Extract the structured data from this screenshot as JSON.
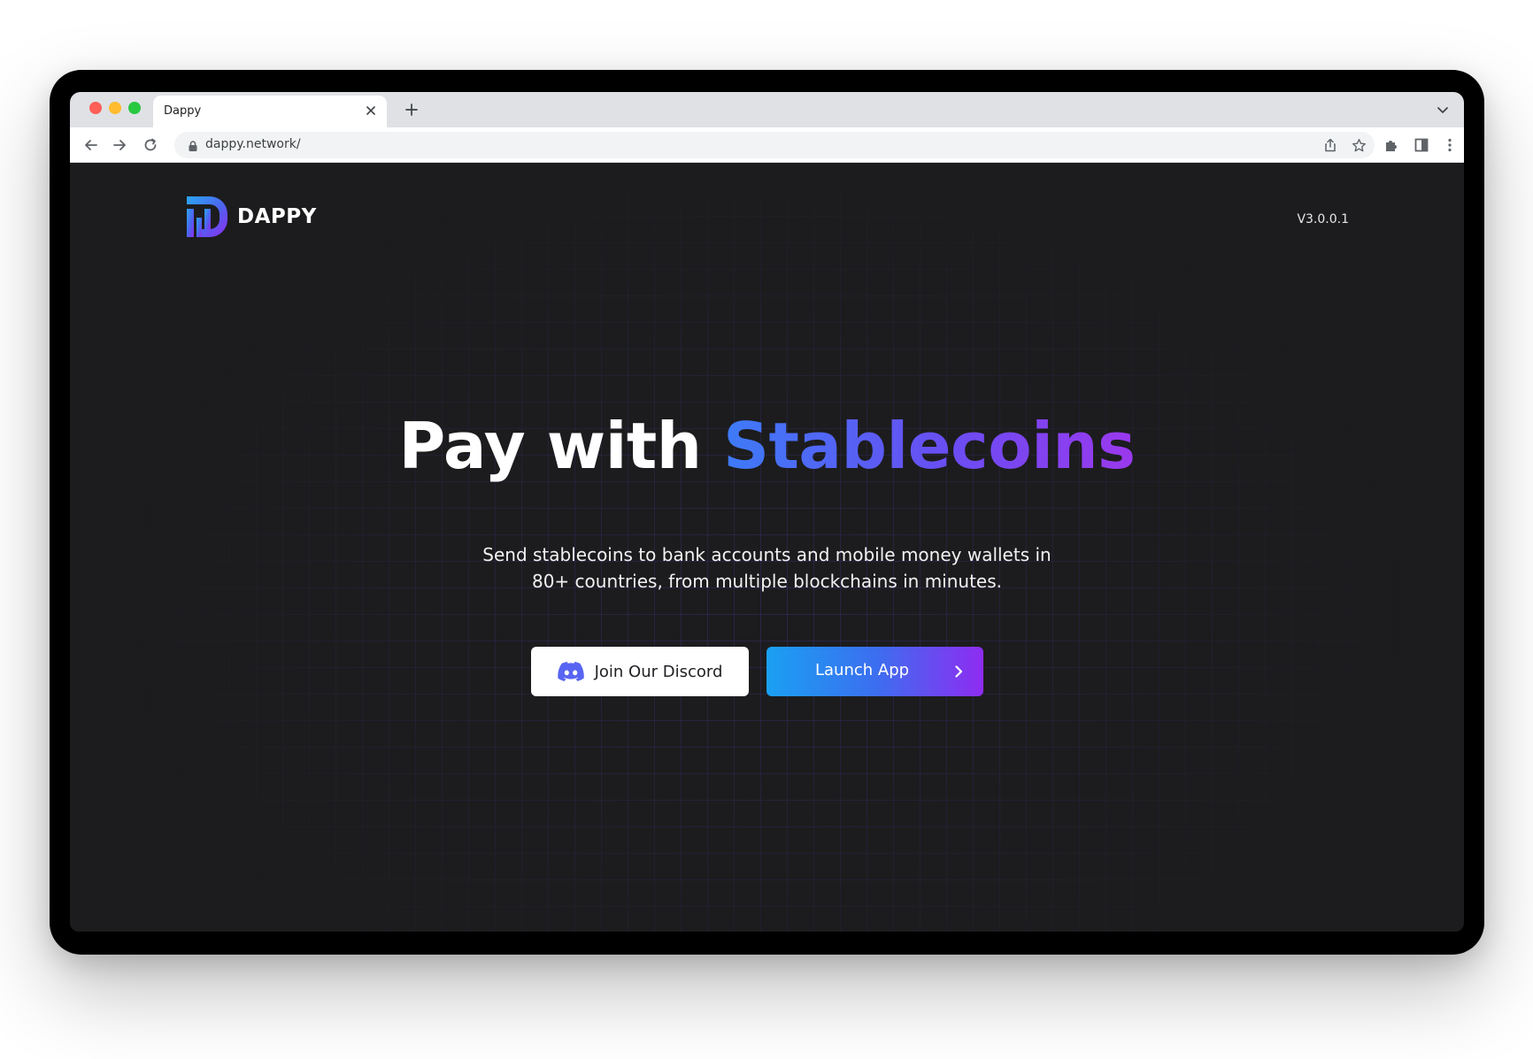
{
  "browser": {
    "tab_title": "Dappy",
    "url": "dappy.network/"
  },
  "icons": {
    "back": "arrow-left-icon",
    "forward": "arrow-right-icon",
    "reload": "reload-icon",
    "lock": "lock-icon",
    "share": "share-icon",
    "bookmark": "star-icon",
    "extensions": "puzzle-icon",
    "sidepanel": "side-panel-icon",
    "menu": "kebab-menu-icon",
    "tab_close": "close-icon",
    "new_tab": "plus-icon",
    "tab_search": "chevron-down-icon",
    "discord": "discord-icon",
    "chevron": "chevron-right-icon"
  },
  "header": {
    "logo_text": "DAPPY",
    "version": "V3.0.0.1"
  },
  "hero": {
    "title_plain": "Pay with ",
    "title_accent": "Stablecoins",
    "subtitle_line1": "Send stablecoins to bank accounts and mobile money wallets in",
    "subtitle_line2": "80+ countries, from multiple blockchains in minutes."
  },
  "actions": {
    "discord_label": "Join Our Discord",
    "launch_label": "Launch App"
  },
  "colors": {
    "page_bg": "#1c1c1e",
    "accent_start": "#3d7bf7",
    "accent_end": "#9b38ee",
    "discord_brand": "#5865f2"
  }
}
